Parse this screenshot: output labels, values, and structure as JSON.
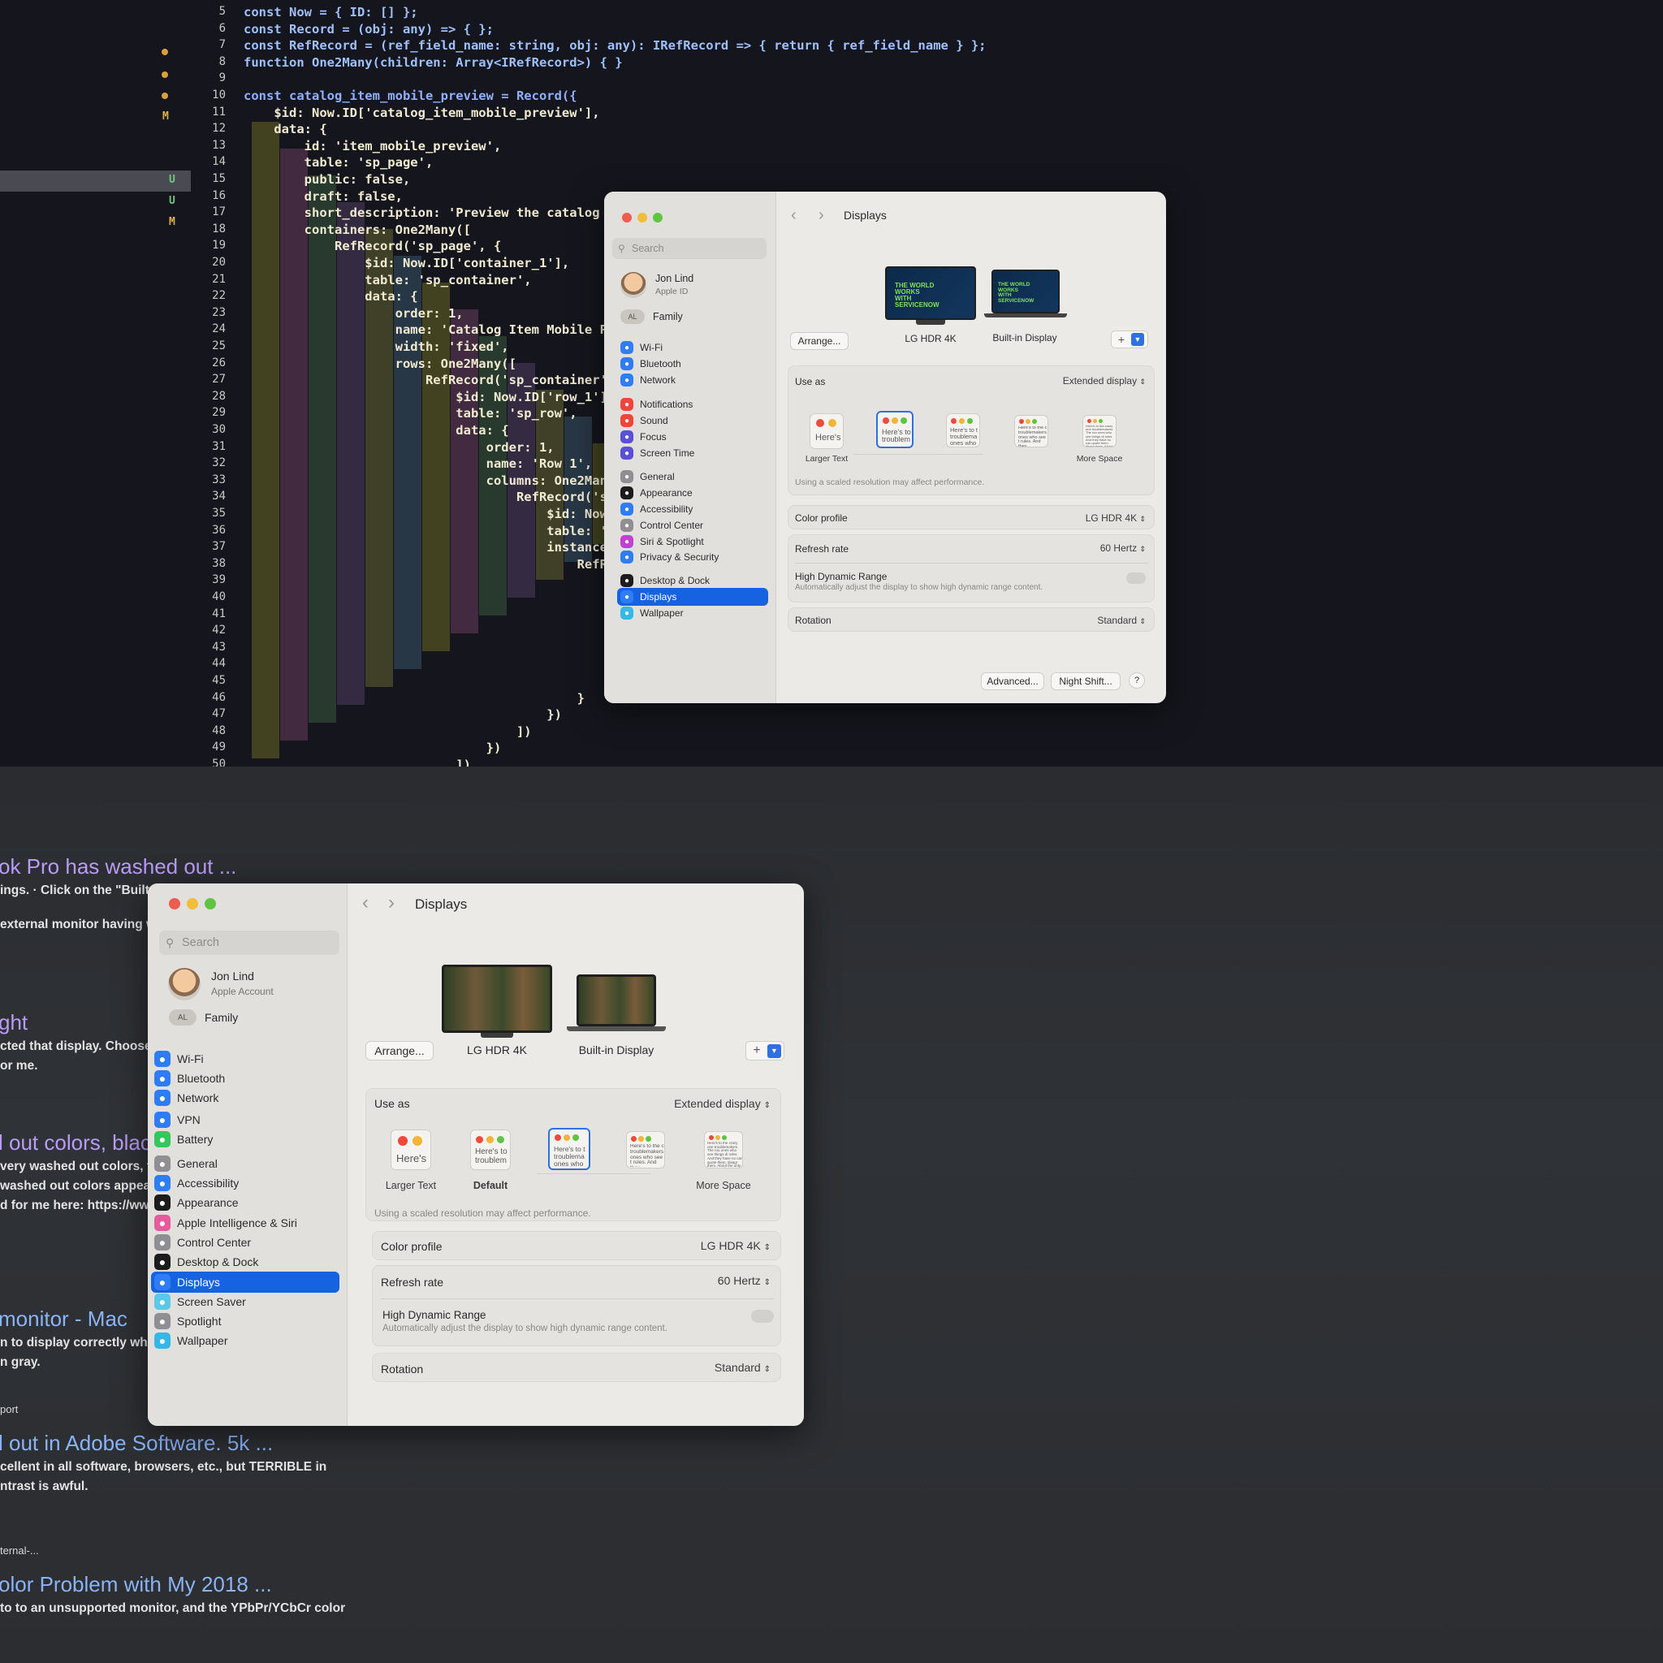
{
  "editor": {
    "gutter_marks": [
      "M",
      "U",
      "U",
      "M"
    ],
    "line_numbers": [
      "5",
      "6",
      "7",
      "8",
      "9",
      "10",
      "11",
      "12",
      "13",
      "14",
      "15",
      "16",
      "17",
      "18",
      "19",
      "20",
      "21",
      "22",
      "23",
      "24",
      "25",
      "26",
      "27",
      "28",
      "29",
      "30",
      "31",
      "32",
      "33",
      "34",
      "35",
      "36",
      "37",
      "38",
      "39",
      "40",
      "41",
      "42",
      "43",
      "44",
      "45",
      "46",
      "47",
      "48",
      "49",
      "50"
    ],
    "lines": [
      "const Now = { ID: [] };",
      "const Record = (obj: any) => { };",
      "const RefRecord = (ref_field_name: string, obj: any): IRefRecord => { return { ref_field_name } };",
      "function One2Many(children: Array<IRefRecord>) { }",
      "",
      "const catalog_item_mobile_preview = Record({",
      "    $id: Now.ID['catalog_item_mobile_preview'],",
      "    data: {",
      "        id: 'item_mobile_preview',",
      "        table: 'sp_page',",
      "        public: false,",
      "        draft: false,",
      "        short_description: 'Preview the catalog ite",
      "        containers: One2Many([",
      "            RefRecord('sp_page', {",
      "                $id: Now.ID['container_1'],",
      "                table: 'sp_container',",
      "                data: {",
      "                    order: 1,",
      "                    name: 'Catalog Item Mobile Prev",
      "                    width: 'fixed',",
      "                    rows: One2Many([",
      "                        RefRecord('sp_container', {",
      "                            $id: Now.ID['row_1'],",
      "                            table: 'sp_row',",
      "                            data: {",
      "                                order: 1,",
      "                                name: 'Row 1',",
      "                                columns: One2Many([",
      "                                    RefRecord('sp_r",
      "                                        $id: Now.ID",
      "                                        table: 'sp_",
      "                                        instances:",
      "                                            RefReco",
      "                                                $id",
      "                                                dat",
      "",
      "",
      "",
      "",
      "",
      "                                            }",
      "                                        })",
      "                                    ])",
      "                                })",
      "                            ])"
    ]
  },
  "window1": {
    "search_placeholder": "Search",
    "user_name": "Jon Lind",
    "user_sub": "Apple ID",
    "family": "Family",
    "items": [
      {
        "label": "Wi-Fi",
        "icon": "wifi-icon",
        "color": "#2f7df6"
      },
      {
        "label": "Bluetooth",
        "icon": "bluetooth-icon",
        "color": "#2f7df6"
      },
      {
        "label": "Network",
        "icon": "globe-icon",
        "color": "#2f7df6"
      },
      {
        "label": "Notifications",
        "icon": "bell-icon",
        "color": "#f0453a"
      },
      {
        "label": "Sound",
        "icon": "speaker-icon",
        "color": "#f0453a"
      },
      {
        "label": "Focus",
        "icon": "moon-icon",
        "color": "#5a4fd6"
      },
      {
        "label": "Screen Time",
        "icon": "hourglass-icon",
        "color": "#5a4fd6"
      },
      {
        "label": "General",
        "icon": "gear-icon",
        "color": "#8e8e93"
      },
      {
        "label": "Appearance",
        "icon": "appearance-icon",
        "color": "#1c1c1e"
      },
      {
        "label": "Accessibility",
        "icon": "accessibility-icon",
        "color": "#2f7df6"
      },
      {
        "label": "Control Center",
        "icon": "control-center-icon",
        "color": "#8e8e93"
      },
      {
        "label": "Siri & Spotlight",
        "icon": "siri-icon",
        "color": "#c23fd1"
      },
      {
        "label": "Privacy & Security",
        "icon": "hand-icon",
        "color": "#2f7df6"
      },
      {
        "label": "Desktop & Dock",
        "icon": "dock-icon",
        "color": "#1c1c1e"
      },
      {
        "label": "Displays",
        "icon": "sun-icon",
        "color": "#2f7df6"
      },
      {
        "label": "Wallpaper",
        "icon": "wallpaper-icon",
        "color": "#37b6e8"
      }
    ],
    "title": "Displays",
    "arrange": "Arrange...",
    "display_1": "LG HDR 4K",
    "display_2": "Built-in Display",
    "monitor_text": "THE WORLD WORKS WITH SERVICENOW",
    "use_as_label": "Use as",
    "use_as_value": "Extended display",
    "thumb_text": "Here's",
    "thumb_text_2": "Here's to troublem",
    "thumb_text_3": "Here's to t troublema ones who",
    "thumb_text_4": "Here's to the c troublemakers ones who see t rules. And they",
    "thumb_text_5": "Here's to the crazy one troublemakers. The rou ones who see things di rules. And they have no can quote them, disagr them. About the only thi Because they change th",
    "larger_text": "Larger Text",
    "more_space": "More Space",
    "scaled_note": "Using a scaled resolution may affect performance.",
    "color_profile_label": "Color profile",
    "color_profile_value": "LG HDR 4K",
    "refresh_label": "Refresh rate",
    "refresh_value": "60 Hertz",
    "hdr_label": "High Dynamic Range",
    "hdr_sub": "Automatically adjust the display to show high dynamic range content.",
    "rotation_label": "Rotation",
    "rotation_value": "Standard",
    "advanced": "Advanced...",
    "night_shift": "Night Shift...",
    "help": "?"
  },
  "window2": {
    "search_placeholder": "Search",
    "user_name": "Jon Lind",
    "user_sub": "Apple Account",
    "family": "Family",
    "items": [
      {
        "label": "Wi-Fi",
        "icon": "wifi-icon",
        "color": "#2f7df6"
      },
      {
        "label": "Bluetooth",
        "icon": "bluetooth-icon",
        "color": "#2f7df6"
      },
      {
        "label": "Network",
        "icon": "globe-icon",
        "color": "#2f7df6"
      },
      {
        "label": "VPN",
        "icon": "vpn-icon",
        "color": "#2f7df6"
      },
      {
        "label": "Battery",
        "icon": "battery-icon",
        "color": "#34c759"
      },
      {
        "label": "General",
        "icon": "gear-icon",
        "color": "#8e8e93"
      },
      {
        "label": "Accessibility",
        "icon": "accessibility-icon",
        "color": "#2f7df6"
      },
      {
        "label": "Appearance",
        "icon": "appearance-icon",
        "color": "#1c1c1e"
      },
      {
        "label": "Apple Intelligence & Siri",
        "icon": "apple-intelligence-icon",
        "color": "#e85a9e"
      },
      {
        "label": "Control Center",
        "icon": "control-center-icon",
        "color": "#8e8e93"
      },
      {
        "label": "Desktop & Dock",
        "icon": "dock-icon",
        "color": "#1c1c1e"
      },
      {
        "label": "Displays",
        "icon": "sun-icon",
        "color": "#2f7df6"
      },
      {
        "label": "Screen Saver",
        "icon": "screen-saver-icon",
        "color": "#5ac8e8"
      },
      {
        "label": "Spotlight",
        "icon": "magnifier-icon",
        "color": "#8e8e93"
      },
      {
        "label": "Wallpaper",
        "icon": "wallpaper-icon",
        "color": "#37b6e8"
      }
    ],
    "title": "Displays",
    "arrange": "Arrange...",
    "display_1": "LG HDR 4K",
    "display_2": "Built-in Display",
    "use_as_label": "Use as",
    "use_as_value": "Extended display",
    "thumb_text": "Here's",
    "thumb_text_2": "Here's to troublem",
    "thumb_text_3": "Here's to t troublema ones who",
    "thumb_text_4": "Here's to the c troublemakers ones who see t rules. And they",
    "thumb_text_5": "Here's to the crazy one troublemakers. The rou ones who see things di rules. And they have no can quote them, disagr them. About the only thi Because they change th",
    "larger_text": "Larger Text",
    "default": "Default",
    "more_space": "More Space",
    "scaled_note": "Using a scaled resolution may affect performance.",
    "color_profile_label": "Color profile",
    "color_profile_value": "LG HDR 4K",
    "refresh_label": "Refresh rate",
    "refresh_value": "60 Hertz",
    "hdr_label": "High Dynamic Range",
    "hdr_sub": "Automatically adjust the display to show high dynamic range content.",
    "rotation_label": "Rotation",
    "rotation_value": "Standard"
  },
  "search_results": [
    {
      "title": "ok Pro has washed out ...",
      "line1": "ings. · Click on the \"Built-i",
      "line2": "external monitor having wa"
    },
    {
      "title": "ght",
      "line1": "cted that display. Choose Ap",
      "line2": "or me."
    },
    {
      "title": "l out colors, blacks",
      "line1": "very washed out colors, the b",
      "line2": "washed out colors appear ...",
      "line3": "d for me here: https://www.kub"
    },
    {
      "title": "monitor - Mac",
      "line1": "n to display correctly when the w",
      "line2": "n gray."
    },
    {
      "title": "l out in Adobe Software. 5k ...",
      "line1": "cellent in all software, browsers, etc., but TERRIBLE in",
      "line2": "ntrast is awful.",
      "pre": "port"
    },
    {
      "title": "olor Problem with My 2018 ...",
      "line1": "to to an unsupported monitor, and the YPbPr/YCbCr color",
      "pre": "ternal-..."
    }
  ]
}
